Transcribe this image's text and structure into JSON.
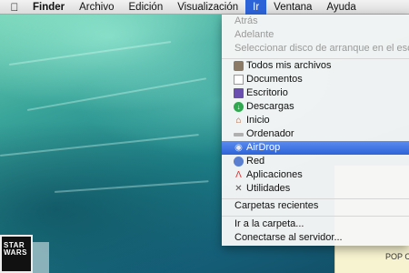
{
  "menubar": {
    "apple": "",
    "items": [
      {
        "label": "Finder"
      },
      {
        "label": "Archivo"
      },
      {
        "label": "Edición"
      },
      {
        "label": "Visualización"
      },
      {
        "label": "Ir"
      },
      {
        "label": "Ventana"
      },
      {
        "label": "Ayuda"
      }
    ]
  },
  "go_menu": {
    "navigation": [
      {
        "label": "Atrás"
      },
      {
        "label": "Adelante"
      },
      {
        "label": "Seleccionar disco de arranque en el escritorio"
      }
    ],
    "places": [
      {
        "label": "Todos mis archivos",
        "icon": "all-files-icon"
      },
      {
        "label": "Documentos",
        "icon": "documents-icon"
      },
      {
        "label": "Escritorio",
        "icon": "desktop-icon"
      },
      {
        "label": "Descargas",
        "icon": "downloads-icon"
      },
      {
        "label": "Inicio",
        "icon": "home-icon"
      },
      {
        "label": "Ordenador",
        "icon": "computer-icon"
      },
      {
        "label": "AirDrop",
        "icon": "airdrop-icon"
      },
      {
        "label": "Red",
        "icon": "network-icon"
      },
      {
        "label": "Aplicaciones",
        "icon": "applications-icon"
      },
      {
        "label": "Utilidades",
        "icon": "utilities-icon"
      }
    ],
    "recent": [
      {
        "label": "Carpetas recientes"
      }
    ],
    "folders": [
      {
        "label": "Ir a la carpeta..."
      },
      {
        "label": "Conectarse al servidor..."
      }
    ]
  },
  "desktop": {
    "star_wars_icon_text": "STAR\nWARS",
    "popup_label": "POP C"
  },
  "colors": {
    "highlight": "#2d63d8",
    "menubar": "#e6e6e6"
  }
}
